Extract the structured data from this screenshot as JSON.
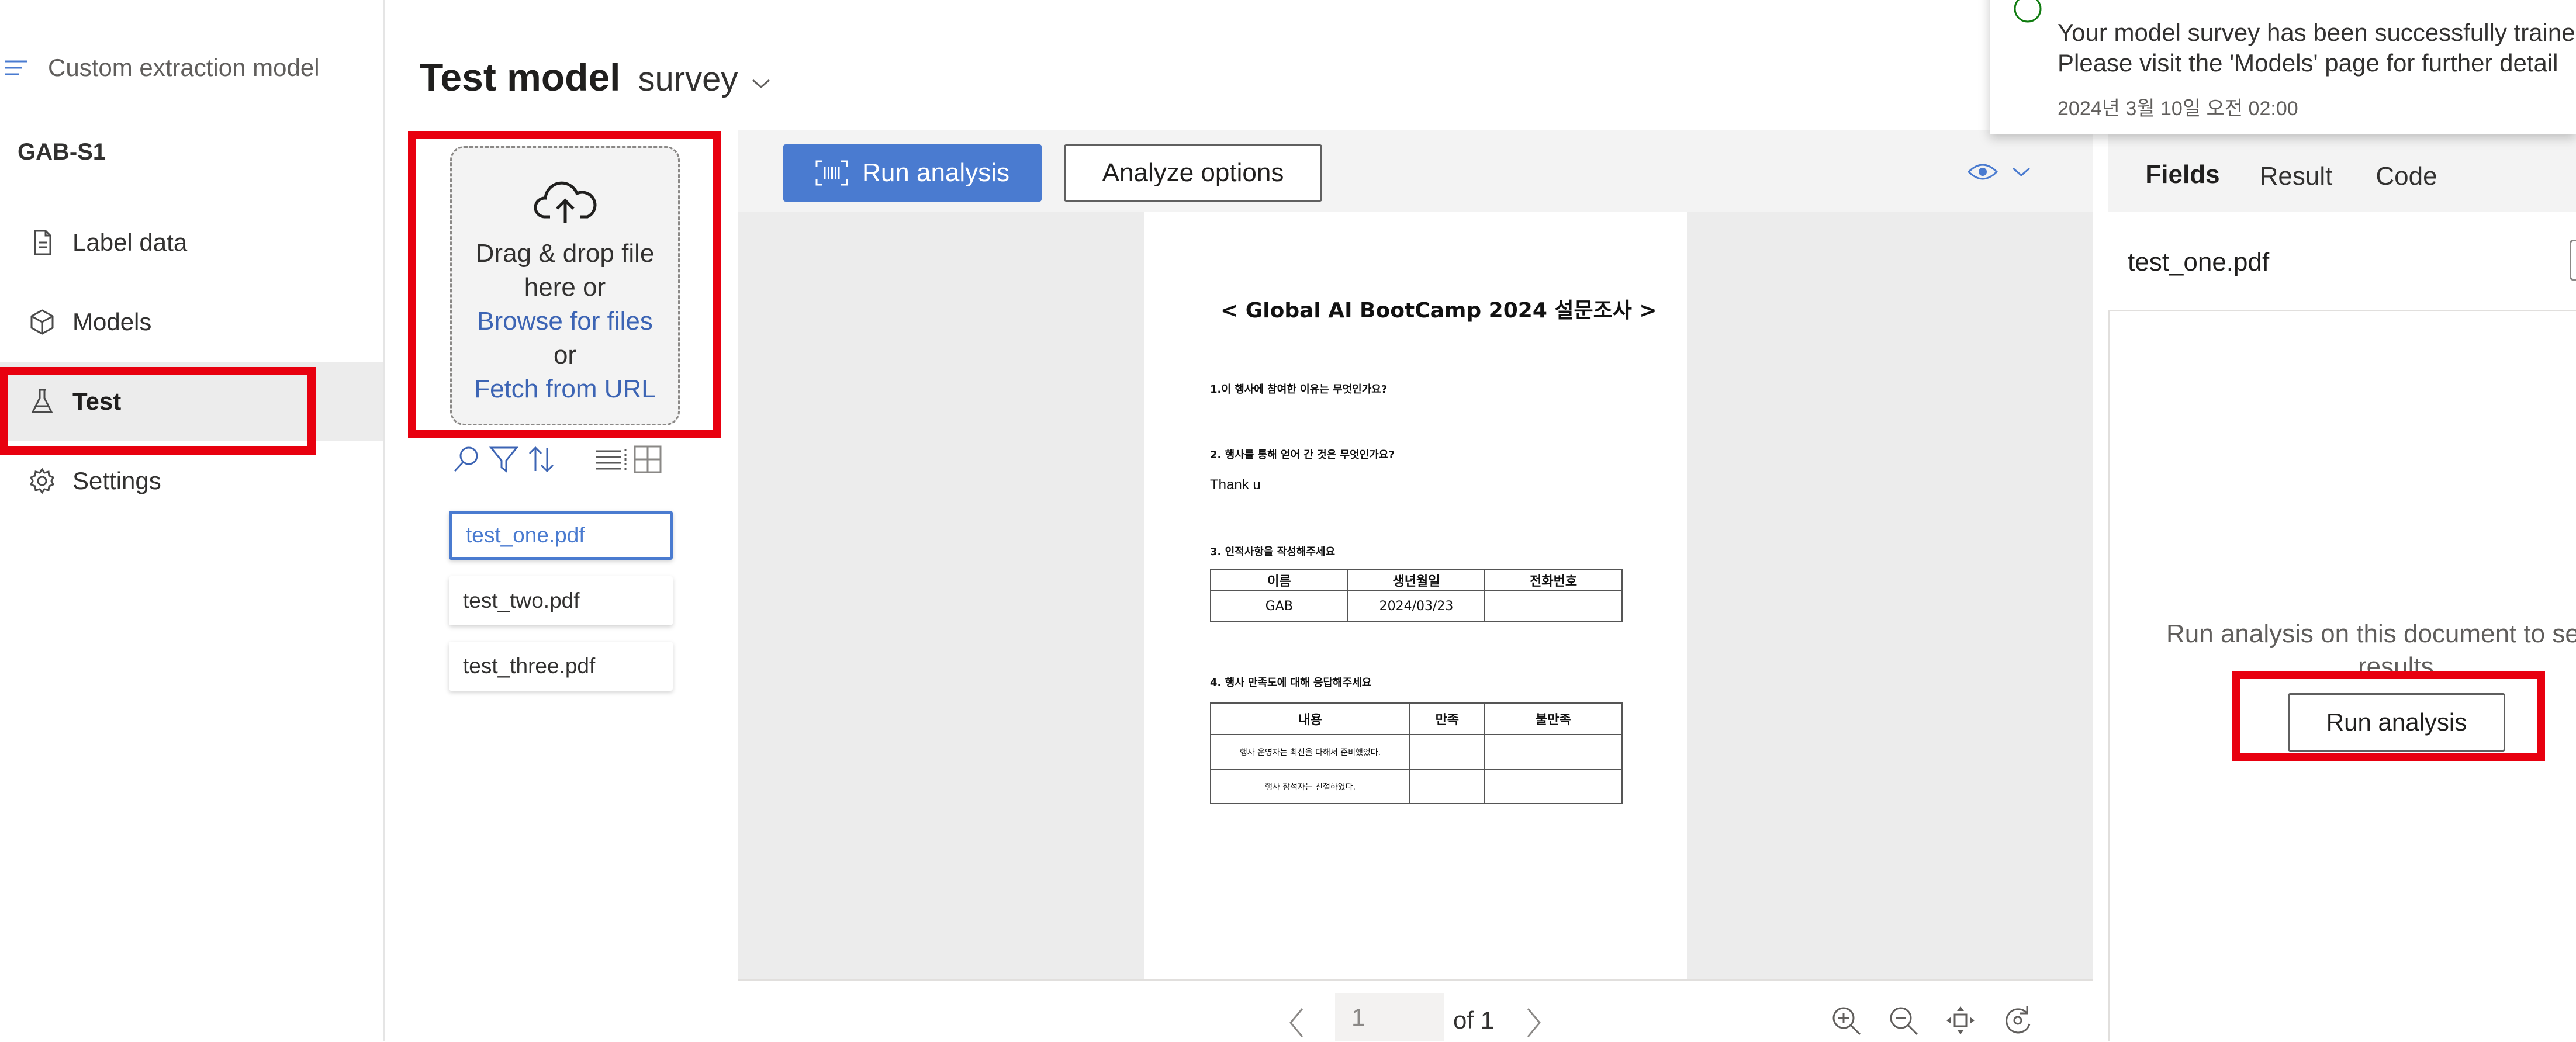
{
  "sidebar": {
    "title": "Custom extraction model",
    "project": "GAB-S1",
    "items": [
      {
        "label": "Label data",
        "icon": "document-icon"
      },
      {
        "label": "Models",
        "icon": "cube-icon"
      },
      {
        "label": "Test",
        "icon": "flask-icon"
      },
      {
        "label": "Settings",
        "icon": "gear-icon"
      }
    ]
  },
  "header": {
    "title": "Test model",
    "model_name": "survey"
  },
  "upload": {
    "line1": "Drag & drop file",
    "line2": "here or",
    "browse": "Browse for files",
    "or": "or",
    "fetch": "Fetch from URL"
  },
  "files": [
    "test_one.pdf",
    "test_two.pdf",
    "test_three.pdf"
  ],
  "toolbar": {
    "run_analysis": "Run analysis",
    "analyze_options": "Analyze options"
  },
  "document": {
    "title": "< Global AI BootCamp 2024 설문조사 >",
    "q1": "1.이 행사에 참여한 이유는 무엇인가요?",
    "q2": "2. 행사를 통해 얻어 간 것은 무엇인가요?",
    "a2": "Thank u",
    "q3": "3. 인적사항을 작성해주세요",
    "table1": {
      "headers": [
        "이름",
        "생년월일",
        "전화번호"
      ],
      "row": [
        "GAB",
        "2024/03/23",
        ""
      ]
    },
    "q4": "4. 행사 만족도에 대해 응답해주세요",
    "table2": {
      "headers": [
        "내용",
        "만족",
        "불만족"
      ],
      "rows": [
        [
          "행사 운영자는 최선을 다해서 준비했었다.",
          "",
          ""
        ],
        [
          "행사 참석자는 친절하였다.",
          "",
          ""
        ]
      ]
    }
  },
  "pager": {
    "page": "1",
    "of": "of 1"
  },
  "right_panel": {
    "tabs": [
      "Fields",
      "Result",
      "Code"
    ],
    "file_name": "test_one.pdf",
    "empty_line1": "Run analysis on this document to see",
    "empty_line2": "results",
    "run_button": "Run analysis"
  },
  "notification": {
    "line1": "Your model survey has been successfully traine",
    "line2": "Please visit the 'Models' page for further detail",
    "timestamp": "2024년 3월 10일 오전 02:00"
  },
  "colors": {
    "accent": "#4a7bd0",
    "highlight": "#e8000f",
    "link": "#3c64b4"
  }
}
